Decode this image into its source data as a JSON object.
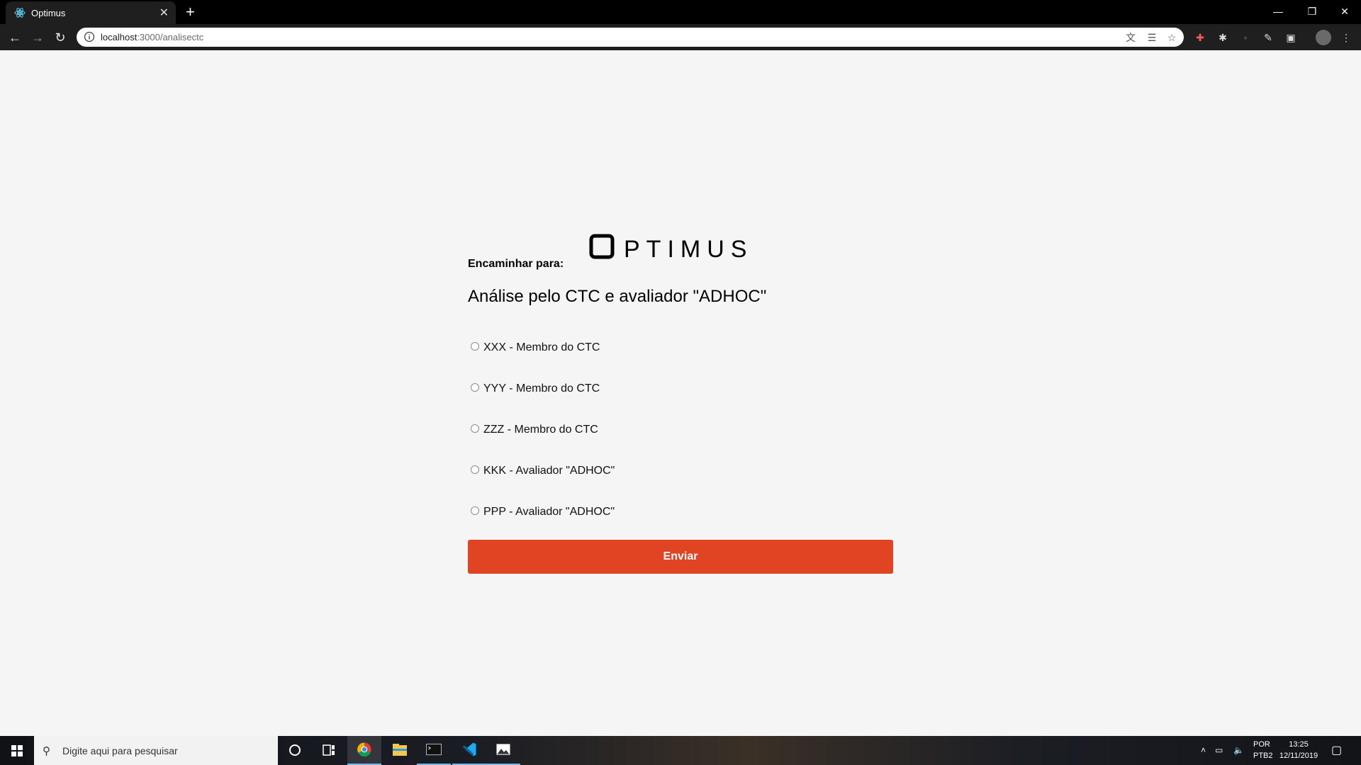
{
  "browser": {
    "tab_title": "Optimus",
    "url_host": "localhost",
    "url_path": ":3000/analisectc",
    "icons": [
      "react-favicon-icon",
      "close-icon",
      "plus-icon",
      "minimize-icon",
      "restore-icon",
      "close-window-icon",
      "back-icon",
      "forward-icon",
      "reload-icon",
      "info-icon",
      "translate-icon",
      "reader-icon",
      "star-icon",
      "extension-icon",
      "profile-avatar-icon",
      "menu-icon"
    ]
  },
  "page": {
    "logo_text": "OPTIMUS",
    "heading": "Análise pelo CTC e avaliador \"ADHOC\"",
    "subheading": "Encaminhar para:",
    "options": [
      {
        "label": "XXX - Membro do CTC"
      },
      {
        "label": "YYY - Membro do CTC"
      },
      {
        "label": "ZZZ - Membro do CTC"
      },
      {
        "label": "KKK - Avaliador \"ADHOC\""
      },
      {
        "label": "PPP - Avaliador \"ADHOC\""
      }
    ],
    "submit_label": "Enviar",
    "accent_color": "#e04422"
  },
  "taskbar": {
    "search_placeholder": "Digite aqui para pesquisar",
    "lang_line1": "POR",
    "lang_line2": "PTB2",
    "time": "13:25",
    "date": "12/11/2019"
  }
}
